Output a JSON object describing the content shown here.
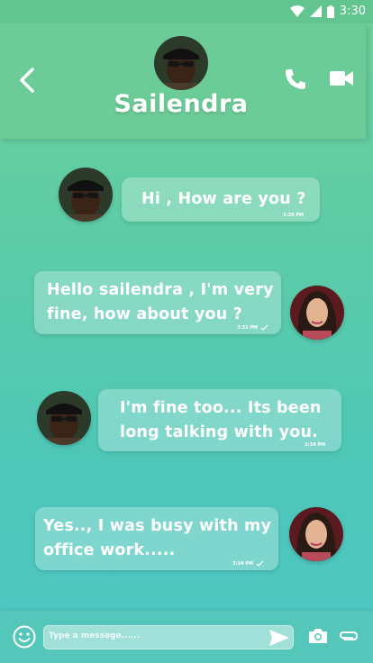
{
  "status": {
    "time": "3:30"
  },
  "header": {
    "contact_name": "Sailendra"
  },
  "messages": [
    {
      "side": "left",
      "text": "Hi , How are you ?",
      "time": "3:30 PM"
    },
    {
      "side": "right",
      "text": "Hello sailendra , I'm very fine, how about you ?",
      "time": "3:32 PM"
    },
    {
      "side": "left",
      "text": "I'm fine too... Its been long talking with you.",
      "time": "3:34 PM"
    },
    {
      "side": "right",
      "text": "Yes.., I was busy with my office work.....",
      "time": "3:34 PM"
    }
  ],
  "composer": {
    "placeholder": "Type a message......"
  },
  "icons": {
    "back": "chevron-left-icon",
    "phone": "phone-icon",
    "video": "video-camera-icon",
    "emoji": "smiley-icon",
    "send": "send-icon",
    "camera": "camera-icon",
    "attach": "paperclip-icon"
  },
  "colors": {
    "header": "#6ccc97",
    "composer": "#55c7ba",
    "text": "#ffffff"
  }
}
